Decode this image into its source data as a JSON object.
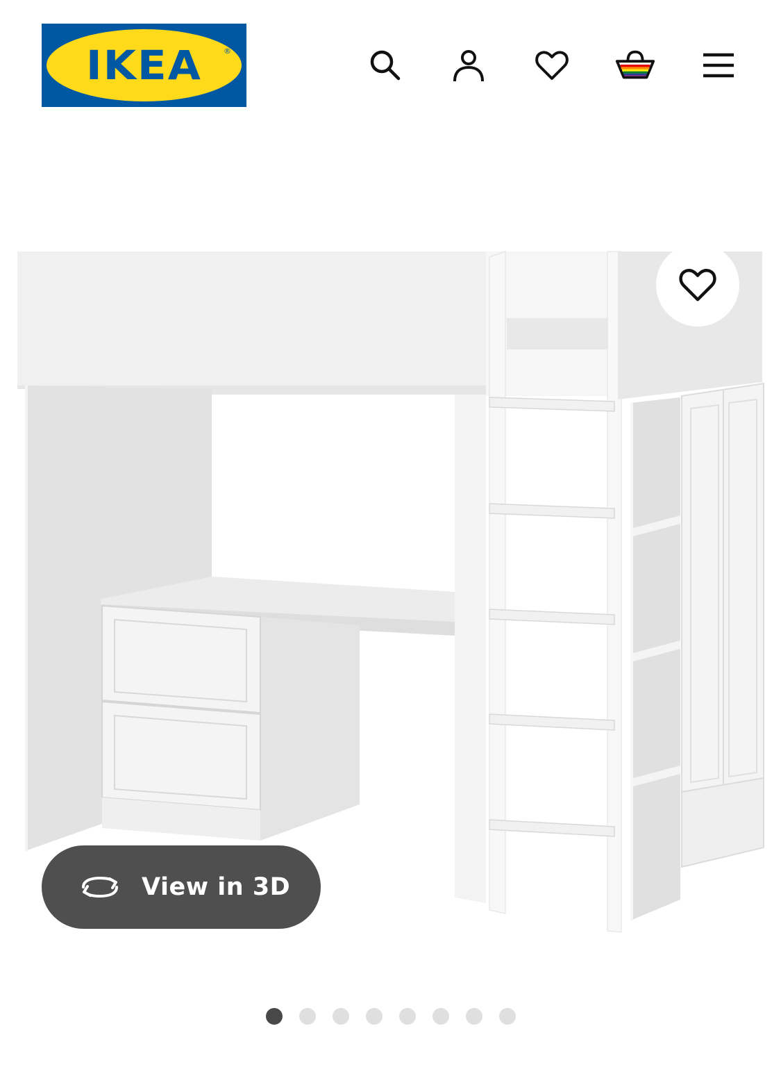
{
  "header": {
    "logo_text": "IKEA",
    "logo_registered": "®",
    "brand_colors": {
      "blue": "#0058a3",
      "yellow": "#ffda1a"
    },
    "icons": [
      "search-icon",
      "account-icon",
      "favourites-icon",
      "shopping-bag-icon",
      "menu-icon"
    ]
  },
  "gallery": {
    "view_3d_label": "View in 3D",
    "view_3d_icon": "rotate-icon",
    "favourite_icon": "heart-icon",
    "slides_total": 8,
    "active_slide": 1
  }
}
